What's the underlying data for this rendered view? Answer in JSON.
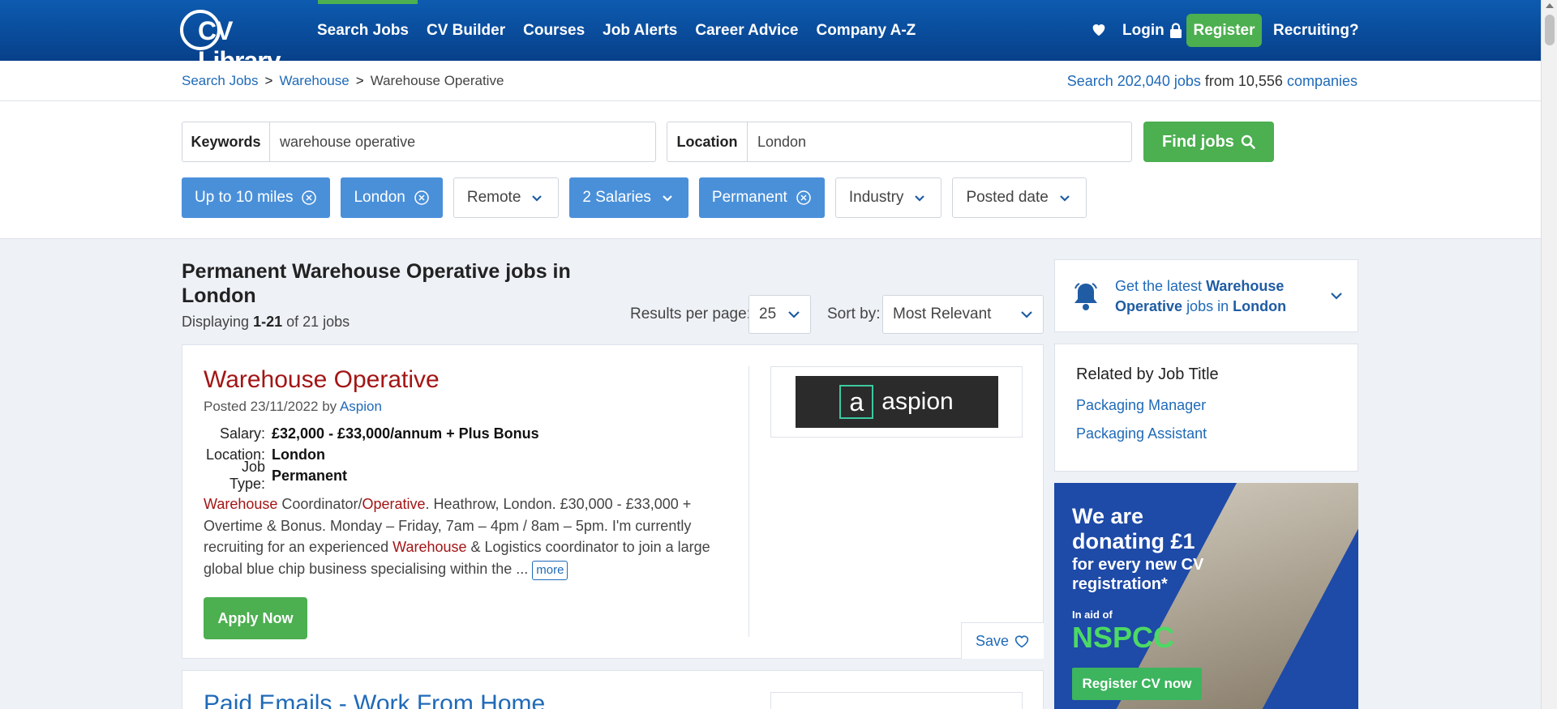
{
  "header": {
    "logo_text": "CV Library",
    "nav": [
      "Search Jobs",
      "CV Builder",
      "Courses",
      "Job Alerts",
      "Career Advice",
      "Company A-Z"
    ],
    "login": "Login",
    "register": "Register",
    "recruiting": "Recruiting?"
  },
  "breadcrumb": {
    "items": [
      "Search Jobs",
      "Warehouse",
      "Warehouse Operative"
    ],
    "separator": ">"
  },
  "stats": {
    "prefix": "Search",
    "jobs_link": "202,040 jobs",
    "middle": "from 10,556",
    "companies_link": "companies"
  },
  "search": {
    "keywords_label": "Keywords",
    "keywords_value": "warehouse operative",
    "location_label": "Location",
    "location_value": "London",
    "find_button": "Find jobs"
  },
  "filters": [
    {
      "label": "Up to 10 miles",
      "active": true
    },
    {
      "label": "London",
      "active": true
    },
    {
      "label": "Remote",
      "active": false
    },
    {
      "label": "2 Salaries",
      "active": true,
      "dropdown": true
    },
    {
      "label": "Permanent",
      "active": true
    },
    {
      "label": "Industry",
      "active": false
    },
    {
      "label": "Posted date",
      "active": false
    }
  ],
  "results": {
    "title": "Permanent Warehouse Operative jobs in London",
    "displaying_prefix": "Displaying",
    "displaying_range": "1-21",
    "displaying_suffix": "of 21 jobs",
    "per_page_label": "Results per page:",
    "per_page_value": "25",
    "sort_label": "Sort by:",
    "sort_value": "Most Relevant"
  },
  "job1": {
    "title": "Warehouse Operative",
    "posted_prefix": "Posted 23/11/2022 by",
    "company": "Aspion",
    "salary_label": "Salary:",
    "salary": "£32,000 - £33,000/annum + Plus Bonus",
    "location_label": "Location:",
    "location": "London",
    "jobtype_label": "Job Type:",
    "jobtype": "Permanent",
    "desc": {
      "p1": "Warehouse",
      "p2": " Coordinator/",
      "p3": "Operative",
      "p4": ". Heathrow, London. £30,000 - £33,000 + Overtime & Bonus. Monday – Friday, 7am – 4pm / 8am – 5pm. I'm currently recruiting for an experienced ",
      "p5": "Warehouse",
      "p6": " & Logistics coordinator to join a large global blue chip business specialising within the ... "
    },
    "more": "more",
    "apply": "Apply Now",
    "logo_text": "aspion",
    "logo_letter": "a",
    "save": "Save"
  },
  "job2": {
    "title": "Paid Emails - Work From Home"
  },
  "sidebar": {
    "alert_prefix": "Get the latest",
    "alert_strong1": "Warehouse Operative",
    "alert_mid": "jobs in",
    "alert_strong2": "London",
    "related_heading": "Related by Job Title",
    "related_links": [
      "Packaging Manager",
      "Packaging Assistant"
    ]
  },
  "ad": {
    "line1": "We are donating £1",
    "line2": "for every new CV registration*",
    "aid": "In aid of",
    "nspcc": "NSPCC",
    "button": "Register CV now"
  },
  "colors": {
    "header": "#0d5bb0",
    "accent_green": "#4caf50",
    "chip_active": "#4a90d9",
    "job_title": "#a31515",
    "link": "#1f6ab8"
  }
}
